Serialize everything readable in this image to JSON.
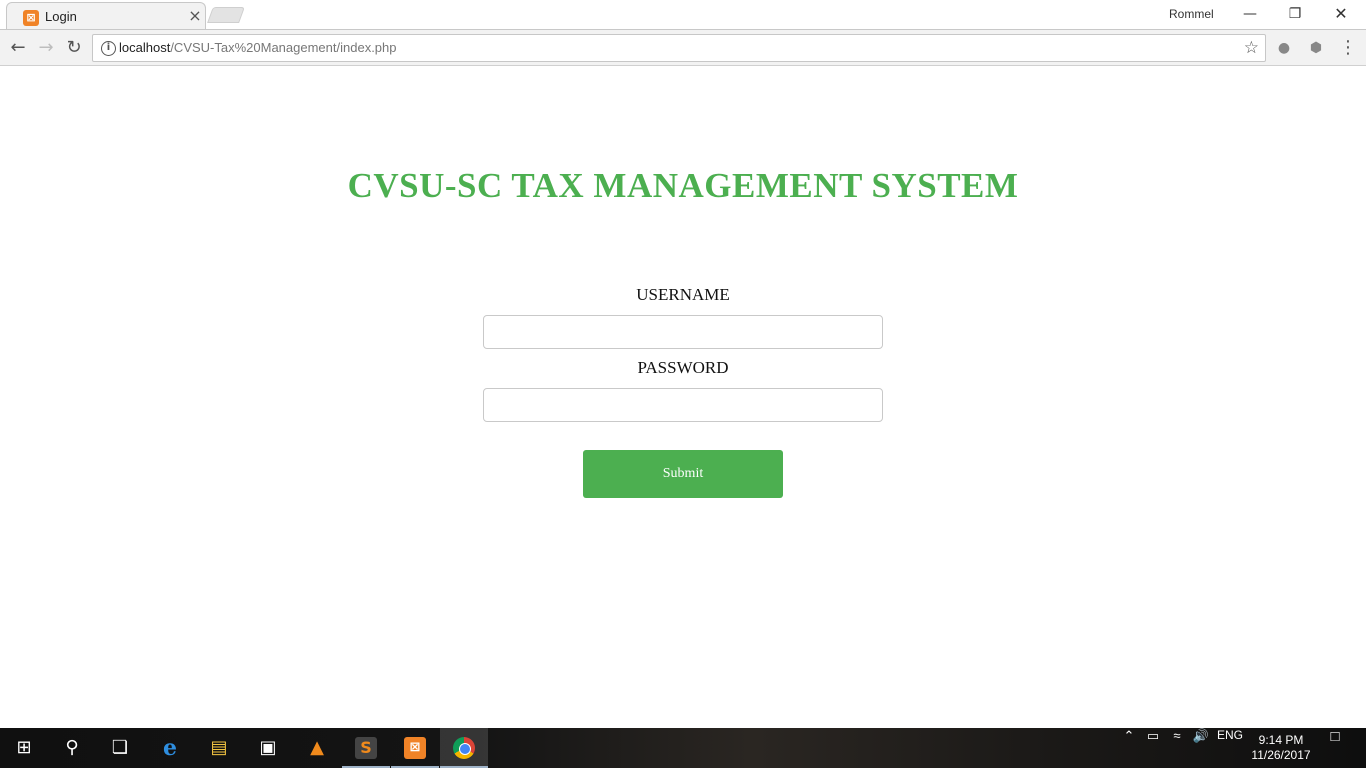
{
  "browser": {
    "tab_title": "Login",
    "tab_favicon": "xampp-icon",
    "tab_close": "×",
    "profile_name": "Rommel",
    "url_host": "localhost",
    "url_path": "/CVSU-Tax%20Management/index.php"
  },
  "page": {
    "title": "CVSU-SC TAX MANAGEMENT SYSTEM",
    "username_label": "USERNAME",
    "username_value": "",
    "password_label": "PASSWORD",
    "password_value": "",
    "submit_label": "Submit",
    "accent_color": "#4caf50"
  },
  "taskbar": {
    "apps": [
      "start-icon",
      "search-icon",
      "task-view-icon",
      "edge-icon",
      "file-explorer-icon",
      "store-icon",
      "vlc-icon",
      "sublime-text-icon",
      "xampp-icon",
      "chrome-icon"
    ],
    "language": "ENG",
    "time": "9:14 PM",
    "date": "11/26/2017"
  }
}
